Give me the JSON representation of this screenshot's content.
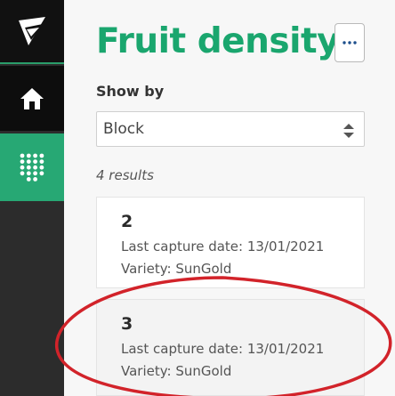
{
  "sidebar": {
    "logo_icon": "brand-logo-icon",
    "items": [
      {
        "icon": "home-icon",
        "active": false
      },
      {
        "icon": "fruit-density-grid-icon",
        "active": true
      }
    ],
    "accent_color": "#27a874"
  },
  "header": {
    "title": "Fruit density",
    "more_icon": "ellipsis-icon"
  },
  "filter": {
    "label": "Show by",
    "selected": "Block"
  },
  "results": {
    "count_text": "4 results",
    "items": [
      {
        "id": "2",
        "capture": "Last capture date: 13/01/2021",
        "variety": "Variety: SunGold"
      },
      {
        "id": "3",
        "capture": "Last capture date: 13/01/2021",
        "variety": "Variety: SunGold"
      }
    ]
  },
  "annotation": {
    "color": "#d2232a"
  }
}
